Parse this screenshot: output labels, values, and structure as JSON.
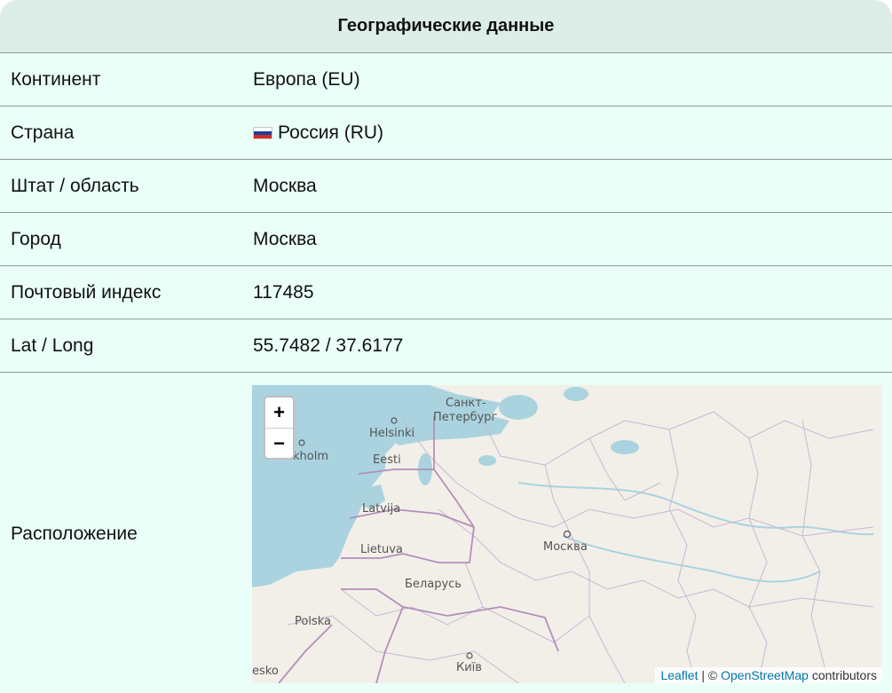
{
  "header": {
    "title": "Географические данные"
  },
  "rows": [
    {
      "label": "Континент",
      "value": "Европа (EU)"
    },
    {
      "label": "Страна",
      "value": "Россия (RU)",
      "flag_icon": "russia-flag-icon"
    },
    {
      "label": "Штат / область",
      "value": "Москва"
    },
    {
      "label": "Город",
      "value": "Москва"
    },
    {
      "label": "Почтовый индекс",
      "value": "117485"
    },
    {
      "label": "Lat / Long",
      "value": "55.7482 / 37.6177"
    }
  ],
  "location": {
    "label": "Расположение",
    "zoom_in": "+",
    "zoom_out": "−",
    "map_labels": {
      "spb": "Санкт-",
      "spb2": "Петербург",
      "helsinki": "Helsinki",
      "stockholm": "kholm",
      "eesti": "Eesti",
      "latvija": "Latvija",
      "lietuva": "Lietuva",
      "moskva": "Москва",
      "belarus": "Беларусь",
      "polska": "Polska",
      "kyiv": "Київ",
      "cesko": "esko"
    },
    "attribution": {
      "leaflet": "Leaflet",
      "sep": " | © ",
      "osm": "OpenStreetMap",
      "contributors": " contributors"
    }
  },
  "colors": {
    "background": "#eafff8",
    "header": "#ddeee9",
    "water": "#aad3df",
    "land": "#f2efe9",
    "border": "#b9a5c8"
  }
}
